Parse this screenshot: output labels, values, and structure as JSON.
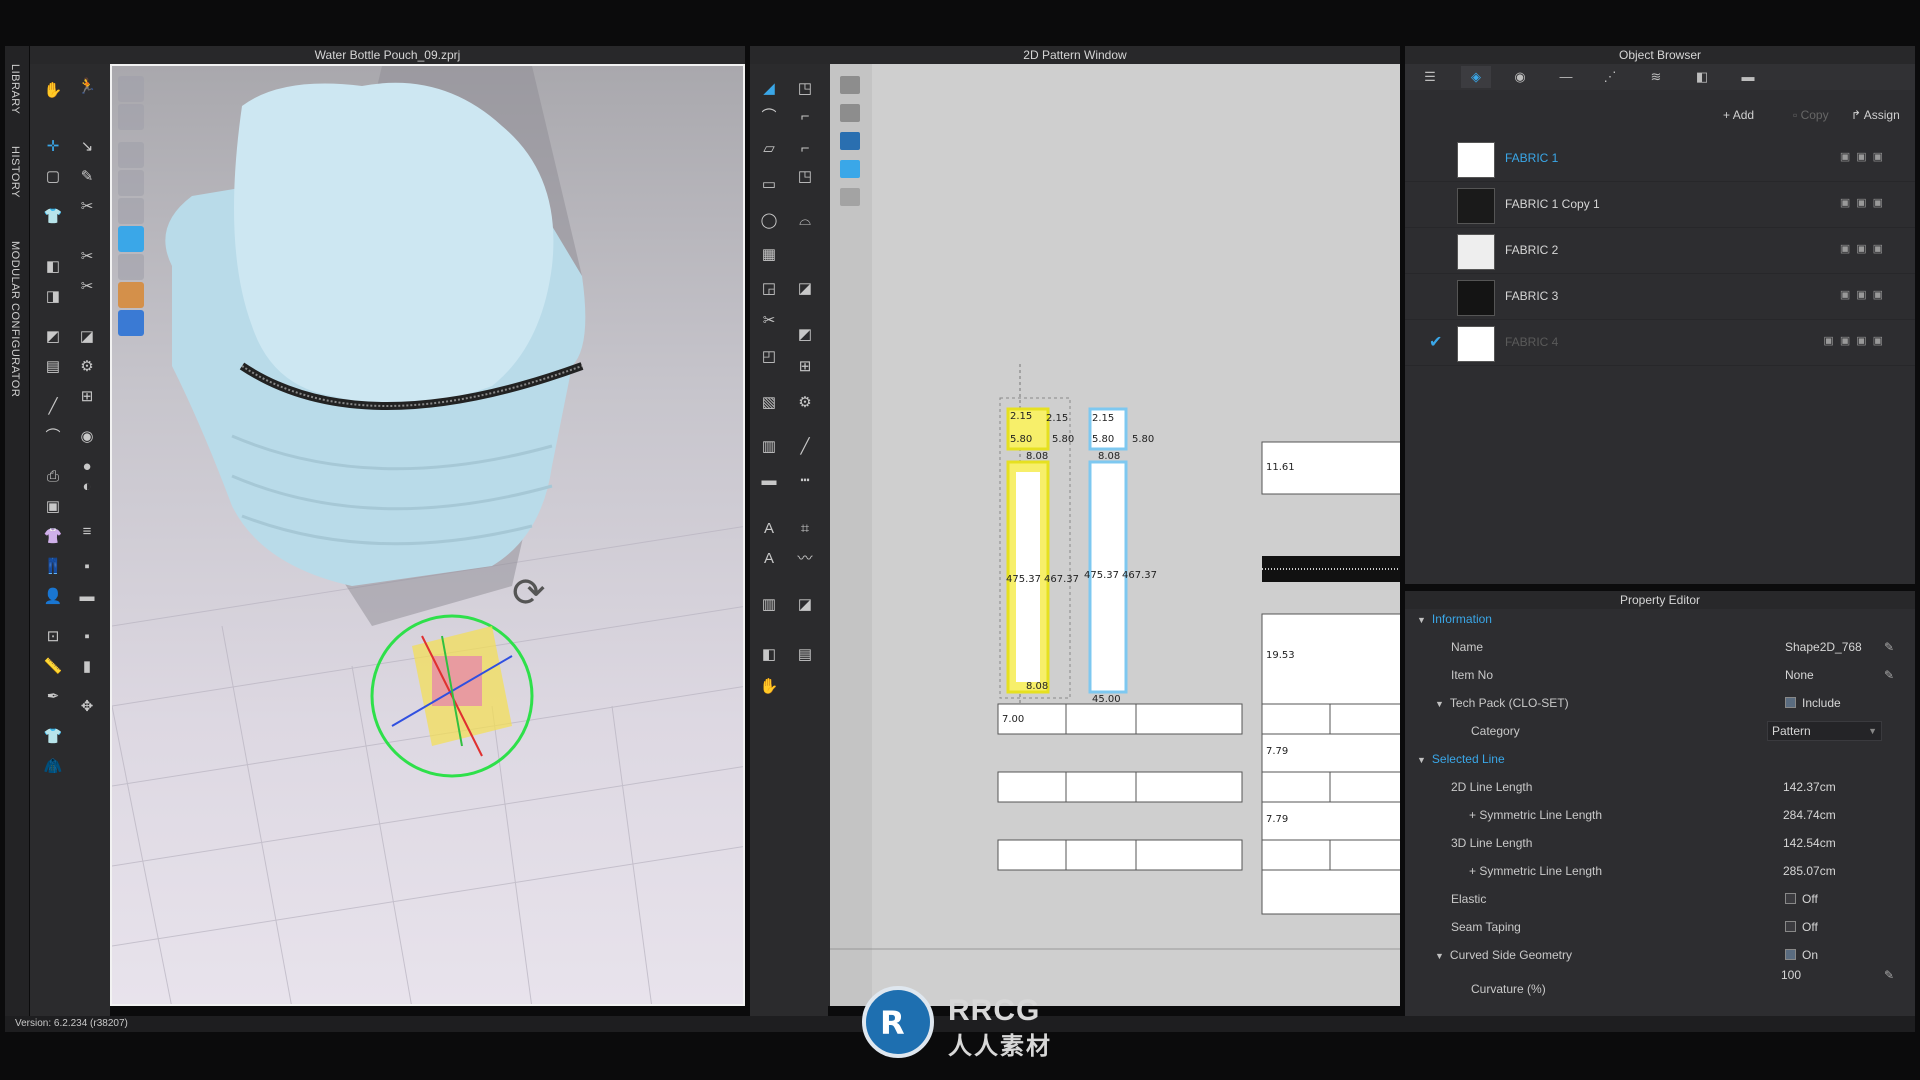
{
  "side_tabs": [
    "LIBRARY",
    "HISTORY",
    "MODULAR CONFIGURATOR"
  ],
  "panel3d": {
    "title": "Water Bottle Pouch_09.zprj"
  },
  "panel2d": {
    "title": "2D Pattern Window",
    "labels": {
      "d215a": "2.15",
      "d215b": "2.15",
      "d215c": "2.15",
      "d580a": "5.80",
      "d580b": "5.80",
      "d580c": "5.80",
      "d580d": "5.80",
      "d808a": "8.08",
      "d808b": "8.08",
      "d808c": "8.08",
      "d4750a": "475.37",
      "d4750b": "467.37",
      "d4750c": "475.37",
      "d4750d": "467.37",
      "d1161": "11.61",
      "d1953": "19.53",
      "d779a": "7.79",
      "d779b": "7.79",
      "d700": "7.00",
      "d4500": "45.00"
    }
  },
  "object_browser": {
    "title": "Object Browser",
    "actions": {
      "add": "Add",
      "copy": "Copy",
      "assign": "Assign"
    },
    "fabrics": [
      {
        "name": "FABRIC 1",
        "color": "#ffffff",
        "selected": true
      },
      {
        "name": "FABRIC 1 Copy 1",
        "color": "#1a1a1a",
        "selected": false
      },
      {
        "name": "FABRIC 2",
        "color": "#eeeeee",
        "selected": false
      },
      {
        "name": "FABRIC 3",
        "color": "#141414",
        "selected": false
      },
      {
        "name": "FABRIC 4",
        "color": "#ffffff",
        "selected": false,
        "checked": true,
        "dimmed": true
      }
    ]
  },
  "property_editor": {
    "title": "Property Editor",
    "information": "Information",
    "name_label": "Name",
    "name_value": "Shape2D_768",
    "itemno_label": "Item No",
    "itemno_value": "None",
    "techpack_label": "Tech Pack (CLO-SET)",
    "techpack_value": "Include",
    "category_label": "Category",
    "category_value": "Pattern",
    "selected_line": "Selected Line",
    "len2d_label": "2D Line Length",
    "len2d_value": "142.37cm",
    "sym1_label": "+ Symmetric Line Length",
    "sym1_value": "284.74cm",
    "len3d_label": "3D Line Length",
    "len3d_value": "142.54cm",
    "sym2_label": "+ Symmetric Line Length",
    "sym2_value": "285.07cm",
    "elastic_label": "Elastic",
    "elastic_value": "Off",
    "seam_label": "Seam Taping",
    "seam_value": "Off",
    "curved_label": "Curved Side Geometry",
    "curved_value": "On",
    "curvature_label": "Curvature (%)",
    "curvature_value": "100"
  },
  "status": {
    "version": "Version: 6.2.234 (r38207)"
  },
  "watermark": {
    "text1": "RRCG",
    "text2": "人人素材"
  },
  "colors": {
    "accent": "#3aa7e8",
    "panel": "#2d2d30",
    "title": "#28282a"
  }
}
